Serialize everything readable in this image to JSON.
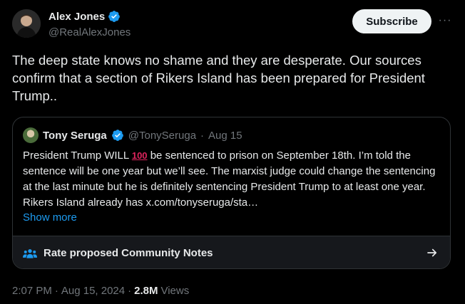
{
  "author": {
    "name": "Alex Jones",
    "handle": "@RealAlexJones",
    "verified_icon": "verified-badge-icon",
    "accent": "#1d9bf0"
  },
  "actions": {
    "subscribe_label": "Subscribe",
    "more_label": "···"
  },
  "tweet": {
    "text": "The deep state knows no shame and they are desperate. Our sources confirm that a section of Rikers Island has been prepared for President Trump.."
  },
  "quote": {
    "name": "Tony Seruga",
    "handle": "@TonySeruga",
    "separator": "·",
    "date": "Aug 15",
    "text_before": "President Trump WILL ",
    "emoji": "100",
    "text_after": " be sentenced to prison on September 18th. I’m told the sentence will be one year but we’ll see. The marxist judge could change the sentencing at the last minute but he is definitely sentencing President Trump to at least one year. Rikers Island already has x.com/tonyseruga/sta…",
    "show_more": "Show more"
  },
  "community_notes": {
    "label": "Rate proposed Community Notes",
    "icon": "people-icon",
    "arrow": "arrow-right-icon"
  },
  "meta": {
    "time": "2:07 PM",
    "separator": "·",
    "date": "Aug 15, 2024",
    "separator2": "·",
    "views_count": "2.8M",
    "views_label": "Views"
  }
}
